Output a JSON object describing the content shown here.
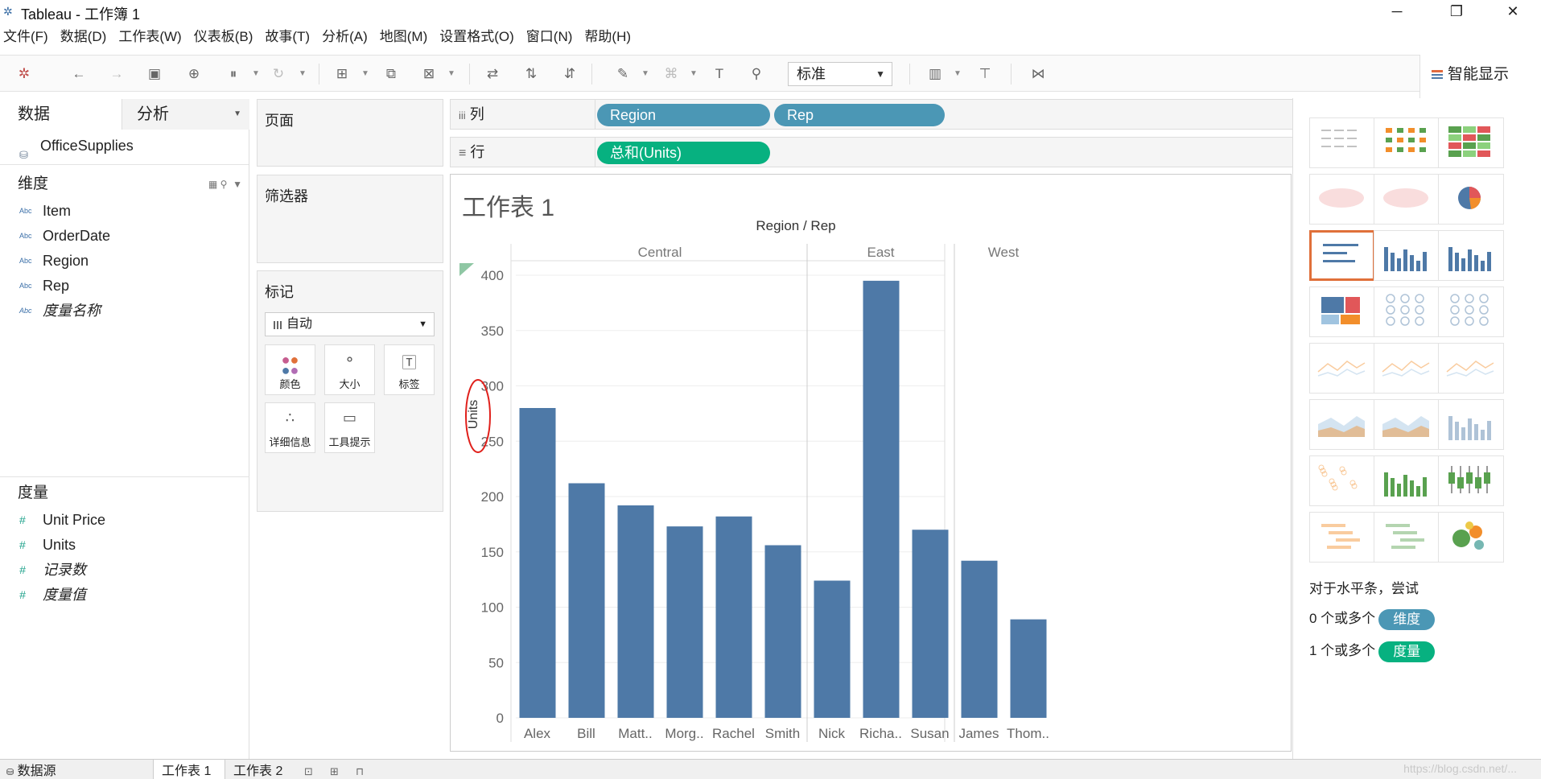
{
  "window": {
    "title": "Tableau - 工作簿 1",
    "minimize": "─",
    "restore": "❐",
    "close": "✕"
  },
  "menu": [
    "文件(F)",
    "数据(D)",
    "工作表(W)",
    "仪表板(B)",
    "故事(T)",
    "分析(A)",
    "地图(M)",
    "设置格式(O)",
    "窗口(N)",
    "帮助(H)"
  ],
  "toolbar": {
    "fit_select": "标准",
    "smart_show": "智能显示"
  },
  "datapane": {
    "tab_data": "数据",
    "tab_analysis": "分析",
    "datasource": "OfficeSupplies",
    "dimensions_header": "维度",
    "dimensions": [
      {
        "type": "Abc",
        "name": "Item"
      },
      {
        "type": "Abc",
        "name": "OrderDate"
      },
      {
        "type": "Abc",
        "name": "Region"
      },
      {
        "type": "Abc",
        "name": "Rep"
      },
      {
        "type": "Abc",
        "name": "度量名称"
      }
    ],
    "measures_header": "度量",
    "measures": [
      {
        "type": "#",
        "name": "Unit Price"
      },
      {
        "type": "#",
        "name": "Units"
      },
      {
        "type": "#",
        "name": "记录数"
      },
      {
        "type": "#",
        "name": "度量值"
      }
    ]
  },
  "cards": {
    "pages": "页面",
    "filters": "筛选器",
    "marks": "标记",
    "marks_type": "自动",
    "marks_buttons": [
      "颜色",
      "大小",
      "标签",
      "详细信息",
      "工具提示"
    ]
  },
  "shelves": {
    "columns_label": "列",
    "rows_label": "行",
    "columns_pills": [
      "Region",
      "Rep"
    ],
    "rows_pills": [
      "总和(Units)"
    ]
  },
  "sheet_title": "工作表 1",
  "chart_data": {
    "type": "bar",
    "title": "Region / Rep",
    "ylabel": "Units",
    "ylim": [
      0,
      420
    ],
    "yticks": [
      0,
      50,
      100,
      150,
      200,
      250,
      300,
      350,
      400
    ],
    "groups": [
      {
        "name": "Central",
        "reps": [
          "Alex",
          "Bill",
          "Matt..",
          "Morg..",
          "Rachel",
          "Smith"
        ],
        "values": [
          280,
          212,
          192,
          173,
          182,
          156
        ]
      },
      {
        "name": "East",
        "reps": [
          "Nick",
          "Richa..",
          "Susan"
        ],
        "values": [
          124,
          395,
          170
        ]
      },
      {
        "name": "West",
        "reps": [
          "James",
          "Thom.."
        ],
        "values": [
          142,
          89
        ]
      }
    ],
    "bar_color": "#4e79a7"
  },
  "showme": {
    "hint_title": "对于水平条，尝试",
    "dim_prefix": "0 个或多个",
    "dim_pill": "维度",
    "mea_prefix": "1 个或多个",
    "mea_pill": "度量"
  },
  "bottom": {
    "datasource_tab": "数据源",
    "sheet1": "工作表 1",
    "sheet2": "工作表 2"
  },
  "watermark": "https://blog.csdn.net/..."
}
